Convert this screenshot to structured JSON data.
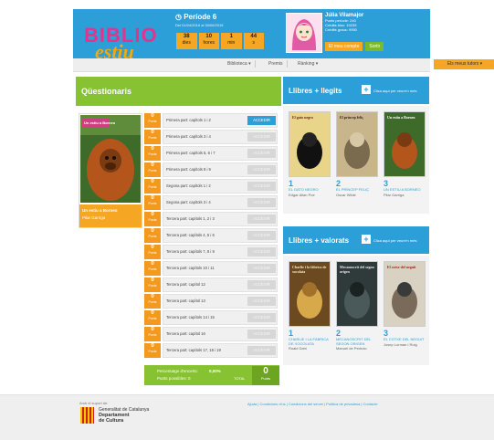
{
  "header": {
    "logo_line1": "BIBLIO",
    "logo_line2": "estiu",
    "period_title": "Període 6",
    "period_dates": "Del 01/04/2016 al 30/06/2016",
    "counters": [
      {
        "value": "38",
        "label": "dies"
      },
      {
        "value": "10",
        "label": "hores"
      },
      {
        "value": "1",
        "label": "min"
      },
      {
        "value": "44",
        "label": "s"
      }
    ],
    "user_name": "Júlia Vilamajor",
    "user_stats": [
      "Punts període: 240",
      "Crèdits bloc: 10235",
      "Crèdits graus: 9950"
    ],
    "my_account": "El meu compte",
    "logout": "Sortir"
  },
  "nav": {
    "items": [
      "Biblioteca ▾",
      "Premis",
      "Rànking ▾"
    ],
    "tutors": "Els meus tutors ▾"
  },
  "questionaris": {
    "title": "Qüestionaris",
    "book_title": "Un estiu a Borneo",
    "book_author": "Pilar Garriga",
    "cover_text": "Un estiu a Borneo",
    "points_label": "Punts",
    "items": [
      {
        "points": "0",
        "title": "Primera part: capítols 1 i 2",
        "button": "ACCEDIR",
        "active": true
      },
      {
        "points": "0",
        "title": "Primera part: capítols 3 i 4",
        "button": "ACCEDIR",
        "active": false
      },
      {
        "points": "0",
        "title": "Primera part: capítols 5, 6 i 7",
        "button": "ACCEDIR",
        "active": false
      },
      {
        "points": "0",
        "title": "Primera part: capítols 8 i 9",
        "button": "ACCEDIR",
        "active": false
      },
      {
        "points": "0",
        "title": "Segona part: capítols 1 i 2",
        "button": "ACCEDIR",
        "active": false
      },
      {
        "points": "0",
        "title": "Segona part: capítols 3 i 4",
        "button": "ACCEDIR",
        "active": false
      },
      {
        "points": "0",
        "title": "Tercera part: capítols 1, 2 i 3",
        "button": "ACCEDIR",
        "active": false
      },
      {
        "points": "0",
        "title": "Tercera part: capítols 4, 5 i 6",
        "button": "ACCEDIR",
        "active": false
      },
      {
        "points": "0",
        "title": "Tercera part: capítols 7, 8 i 9",
        "button": "ACCEDIR",
        "active": false
      },
      {
        "points": "0",
        "title": "Tercera part: capítols 10 i 11",
        "button": "ACCEDIR",
        "active": false
      },
      {
        "points": "0",
        "title": "Tercera part: capítol 12",
        "button": "ACCEDIR",
        "active": false
      },
      {
        "points": "0",
        "title": "Tercera part: capítol 13",
        "button": "ACCEDIR",
        "active": false
      },
      {
        "points": "0",
        "title": "Tercera part: capítols 14 i 15",
        "button": "ACCEDIR",
        "active": false
      },
      {
        "points": "0",
        "title": "Tercera part: capítol 16",
        "button": "ACCEDIR",
        "active": false
      },
      {
        "points": "0",
        "title": "Tercera part: capítols 17, 18 i 19",
        "button": "ACCEDIR",
        "active": false
      }
    ],
    "footer_pct_label": "Percentatge d'encerts:",
    "footer_pct_value": "0,00%",
    "footer_possible": "Punts possibles: 0",
    "footer_total_label": "TOTAL",
    "footer_total_value": "0",
    "footer_total_unit": "Punts"
  },
  "read": {
    "title": "Llibres + llegits",
    "link": "Clica aquí per veure'n més",
    "books": [
      {
        "num": "1",
        "title": "EL GATO NEGRO",
        "author": "Edgar Allan Poe",
        "cover": "El gato negro"
      },
      {
        "num": "2",
        "title": "EL PRÍNCEP FELIÇ",
        "author": "Oscar Wilde",
        "cover": "El príncep feliç"
      },
      {
        "num": "3",
        "title": "UN ESTIU A BORNEO",
        "author": "Pilar Garriga",
        "cover": "Un estiu a Borneo"
      }
    ]
  },
  "rated": {
    "title": "Llibres + valorats",
    "link": "Clica aquí per veure'n més",
    "books": [
      {
        "num": "1",
        "title": "CHARLIE I LA FÀBRICA DE XOCOLATA",
        "author": "Roald Dahl",
        "cover": "Charlie i la fàbrica de xocolata"
      },
      {
        "num": "2",
        "title": "MECANOSCRIT DEL SEGON ORIGEN",
        "author": "Manuel de Pedrolo",
        "cover": "Mecanoscrit del segon origen"
      },
      {
        "num": "3",
        "title": "EL COTXE DEL NEGUIT",
        "author": "Josep Lorman i Roig",
        "cover": "El cotxe del neguit"
      }
    ]
  },
  "footer": {
    "support": "Amb el suport de:",
    "gen": "Generalitat de Catalunya",
    "dep1": "Departament",
    "dep2": "de Cultura",
    "links": "Ajuda  |  Condicions d'ús  |  Condicions del servei  |  Política de privadesa  |  Contacte"
  },
  "colors": {
    "blue": "#2d9fd8",
    "green": "#86c232",
    "orange": "#f5a623"
  }
}
